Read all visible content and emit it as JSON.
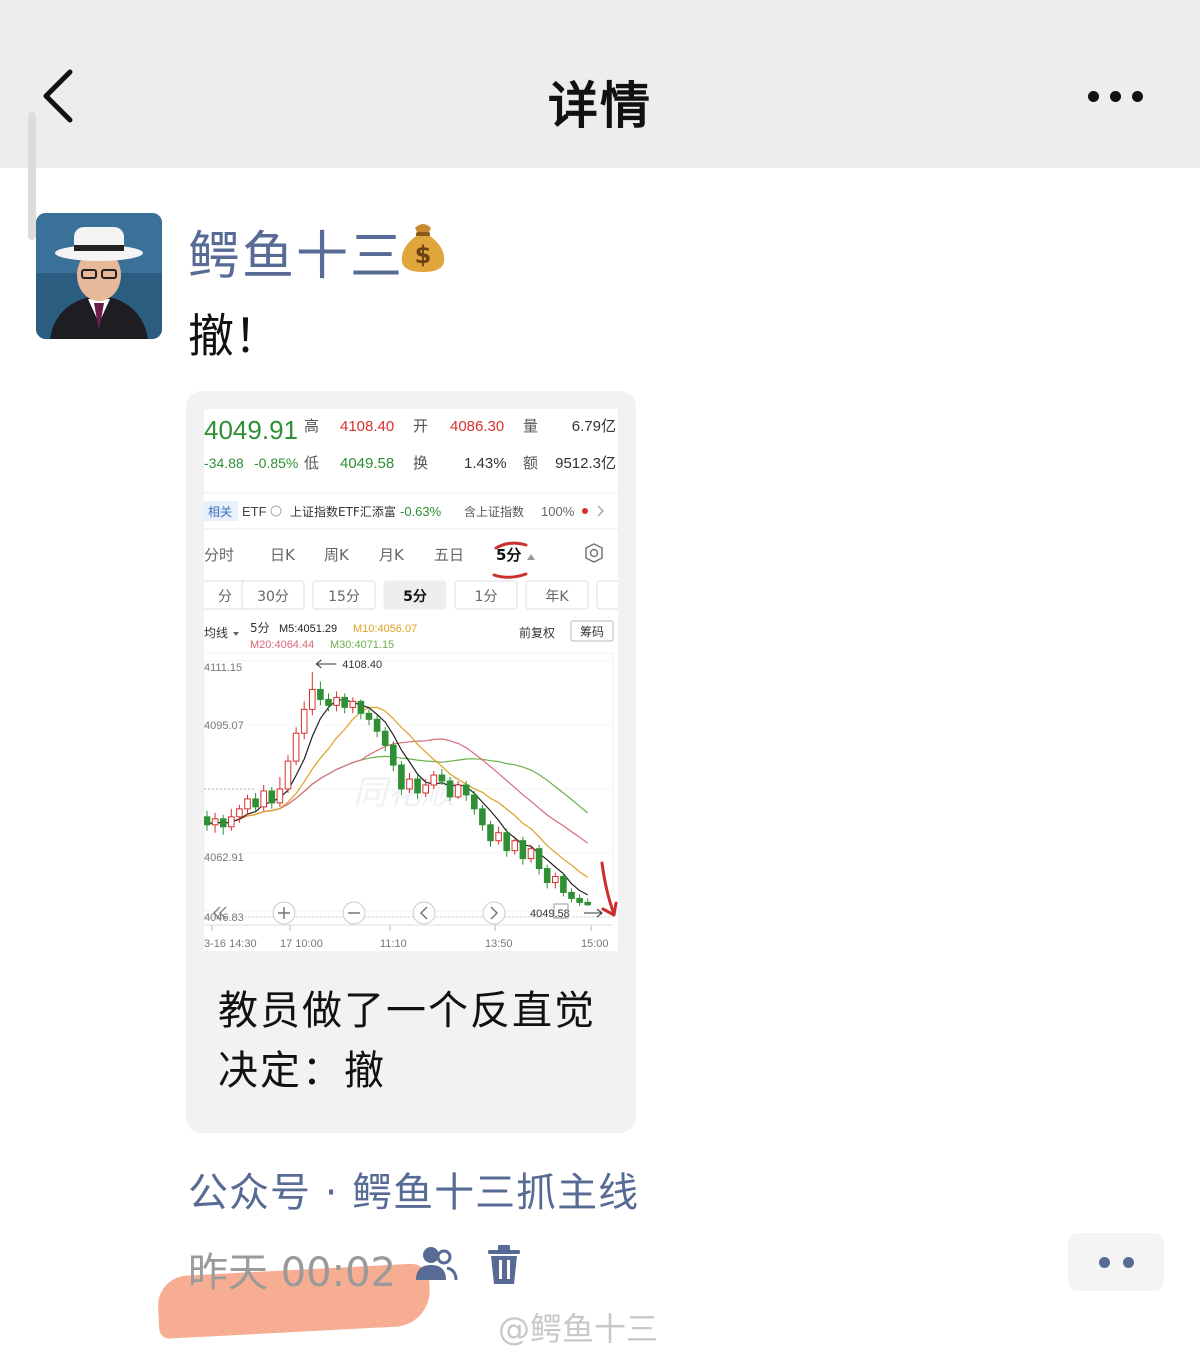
{
  "header": {
    "title": "详情",
    "back_icon": "chevron-left-icon",
    "more_icon": "more-horizontal-icon"
  },
  "post": {
    "username": "鳄鱼十三",
    "emoji": "money-bag-icon",
    "text": "撤！",
    "card_title": "教员做了一个反直觉决定：撤",
    "account": "公众号 · 鳄鱼十三抓主线",
    "time": "昨天 00:02",
    "watermark": "@鳄鱼十三"
  },
  "stock": {
    "price": "4049.91",
    "change": "-34.88",
    "change_pct": "-0.85%",
    "labels": {
      "high": "高",
      "low": "低",
      "open": "开",
      "turnover": "换",
      "volume": "量",
      "amount": "额"
    },
    "high": "4108.40",
    "low": "4049.58",
    "open": "4086.30",
    "turnover_rate": "1.43%",
    "volume": "6.79亿",
    "amount": "9512.3亿",
    "etf_bar": {
      "tag": "相关",
      "etf": "ETF",
      "name": "上证指数ETF汇添富",
      "pct": "-0.63%",
      "contains": "含上证指数",
      "weight": "100%"
    },
    "tabs": [
      "分时",
      "日K",
      "周K",
      "月K",
      "五日",
      "5分"
    ],
    "active_tab": "5分",
    "periods": [
      "分",
      "30分",
      "15分",
      "5分",
      "1分",
      "年K"
    ],
    "active_period": "5分",
    "indicator": {
      "label": "均线",
      "period": "5分",
      "m5": "M5:4051.29",
      "m10": "M10:4056.07",
      "m20": "M20:4064.44",
      "m30": "M30:4071.15",
      "adjust": "前复权",
      "chips": "筹码"
    },
    "y_ticks": [
      "4111.15",
      "4095.07",
      "4062.91",
      "4046.83"
    ],
    "x_ticks": [
      "3-16 14:30",
      "17 10:00",
      "11:10",
      "13:50",
      "15:00"
    ],
    "max_annot": "4108.40",
    "min_annot": "4049.58",
    "chart_watermark": "同花顺",
    "colors": {
      "up": "#d9302f",
      "down": "#2f8f35",
      "m5": "#222222",
      "m10": "#e0a020",
      "m20": "#d86a7a",
      "m30": "#6ab04c"
    }
  },
  "chart_data": {
    "type": "candlestick",
    "title": "",
    "xlabel": "",
    "ylabel": "",
    "ylim": [
      4046.83,
      4111.15
    ],
    "candles": [
      {
        "o": 4072.0,
        "c": 4070.0,
        "h": 4073.5,
        "l": 4068.5
      },
      {
        "o": 4070.0,
        "c": 4071.5,
        "h": 4073.0,
        "l": 4068.0
      },
      {
        "o": 4071.5,
        "c": 4069.5,
        "h": 4072.5,
        "l": 4067.5
      },
      {
        "o": 4069.5,
        "c": 4072.0,
        "h": 4074.0,
        "l": 4068.5
      },
      {
        "o": 4072.0,
        "c": 4074.0,
        "h": 4075.0,
        "l": 4070.5
      },
      {
        "o": 4074.0,
        "c": 4076.5,
        "h": 4077.5,
        "l": 4072.5
      },
      {
        "o": 4076.5,
        "c": 4074.5,
        "h": 4078.0,
        "l": 4073.0
      },
      {
        "o": 4074.5,
        "c": 4078.5,
        "h": 4080.0,
        "l": 4073.5
      },
      {
        "o": 4078.5,
        "c": 4075.5,
        "h": 4079.5,
        "l": 4074.0
      },
      {
        "o": 4075.5,
        "c": 4079.0,
        "h": 4082.0,
        "l": 4074.5
      },
      {
        "o": 4079.0,
        "c": 4086.0,
        "h": 4087.5,
        "l": 4078.0
      },
      {
        "o": 4086.0,
        "c": 4093.0,
        "h": 4094.5,
        "l": 4085.0
      },
      {
        "o": 4093.0,
        "c": 4099.0,
        "h": 4101.0,
        "l": 4091.5
      },
      {
        "o": 4099.0,
        "c": 4104.0,
        "h": 4108.4,
        "l": 4097.5
      },
      {
        "o": 4104.0,
        "c": 4101.5,
        "h": 4106.0,
        "l": 4100.0
      },
      {
        "o": 4101.5,
        "c": 4100.0,
        "h": 4103.0,
        "l": 4098.5
      },
      {
        "o": 4100.0,
        "c": 4102.0,
        "h": 4103.5,
        "l": 4098.5
      },
      {
        "o": 4102.0,
        "c": 4099.5,
        "h": 4103.0,
        "l": 4098.0
      },
      {
        "o": 4099.5,
        "c": 4101.0,
        "h": 4102.0,
        "l": 4098.0
      },
      {
        "o": 4101.0,
        "c": 4098.0,
        "h": 4101.5,
        "l": 4096.5
      },
      {
        "o": 4098.0,
        "c": 4096.5,
        "h": 4099.0,
        "l": 4095.0
      },
      {
        "o": 4096.5,
        "c": 4093.5,
        "h": 4097.5,
        "l": 4092.0
      },
      {
        "o": 4093.5,
        "c": 4090.0,
        "h": 4094.5,
        "l": 4088.5
      },
      {
        "o": 4090.0,
        "c": 4085.0,
        "h": 4091.0,
        "l": 4083.5
      },
      {
        "o": 4085.0,
        "c": 4079.0,
        "h": 4086.0,
        "l": 4077.5
      },
      {
        "o": 4079.0,
        "c": 4081.5,
        "h": 4083.0,
        "l": 4078.0
      },
      {
        "o": 4081.5,
        "c": 4078.0,
        "h": 4082.5,
        "l": 4076.5
      },
      {
        "o": 4078.0,
        "c": 4080.0,
        "h": 4081.5,
        "l": 4077.0
      },
      {
        "o": 4080.0,
        "c": 4082.5,
        "h": 4083.5,
        "l": 4079.0
      },
      {
        "o": 4082.5,
        "c": 4081.0,
        "h": 4084.0,
        "l": 4080.0
      },
      {
        "o": 4081.0,
        "c": 4077.0,
        "h": 4082.0,
        "l": 4076.0
      },
      {
        "o": 4077.0,
        "c": 4080.0,
        "h": 4081.0,
        "l": 4076.5
      },
      {
        "o": 4080.0,
        "c": 4077.5,
        "h": 4081.0,
        "l": 4076.0
      },
      {
        "o": 4077.5,
        "c": 4074.0,
        "h": 4078.5,
        "l": 4072.5
      },
      {
        "o": 4074.0,
        "c": 4070.0,
        "h": 4075.0,
        "l": 4068.5
      },
      {
        "o": 4070.0,
        "c": 4066.0,
        "h": 4071.0,
        "l": 4064.5
      },
      {
        "o": 4066.0,
        "c": 4068.0,
        "h": 4069.5,
        "l": 4065.0
      },
      {
        "o": 4068.0,
        "c": 4063.5,
        "h": 4069.0,
        "l": 4062.0
      },
      {
        "o": 4063.5,
        "c": 4066.0,
        "h": 4067.0,
        "l": 4062.5
      },
      {
        "o": 4066.0,
        "c": 4061.5,
        "h": 4067.0,
        "l": 4060.0
      },
      {
        "o": 4061.5,
        "c": 4064.0,
        "h": 4065.0,
        "l": 4060.5
      },
      {
        "o": 4064.0,
        "c": 4059.0,
        "h": 4065.0,
        "l": 4057.5
      },
      {
        "o": 4059.0,
        "c": 4055.5,
        "h": 4060.0,
        "l": 4054.0
      },
      {
        "o": 4055.5,
        "c": 4057.0,
        "h": 4058.0,
        "l": 4054.0
      },
      {
        "o": 4057.0,
        "c": 4053.0,
        "h": 4058.0,
        "l": 4052.0
      },
      {
        "o": 4053.0,
        "c": 4051.5,
        "h": 4054.0,
        "l": 4050.5
      },
      {
        "o": 4051.5,
        "c": 4050.5,
        "h": 4052.5,
        "l": 4049.58
      },
      {
        "o": 4050.5,
        "c": 4049.91,
        "h": 4051.5,
        "l": 4049.58
      }
    ]
  }
}
